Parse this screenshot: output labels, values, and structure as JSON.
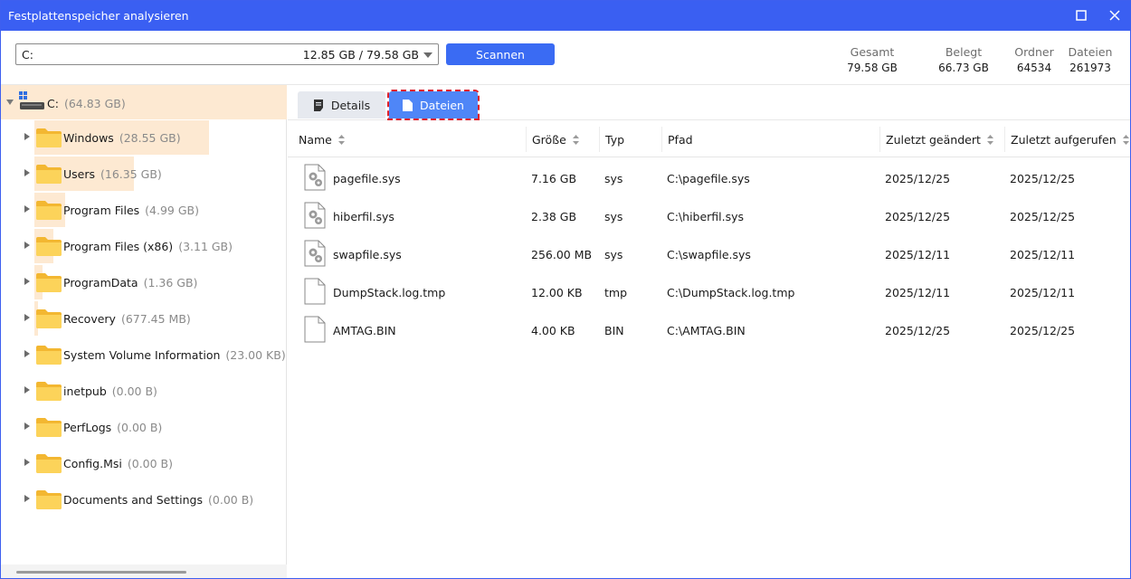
{
  "window": {
    "title": "Festplattenspeicher analysieren"
  },
  "toolbar": {
    "drive_letter": "C:",
    "drive_usage": "12.85 GB / 79.58 GB",
    "scan_label": "Scannen"
  },
  "stats": [
    {
      "label": "Gesamt",
      "value": "79.58 GB"
    },
    {
      "label": "Belegt",
      "value": "66.73 GB"
    },
    {
      "label": "Ordner",
      "value": "64534"
    },
    {
      "label": "Dateien",
      "value": "261973"
    }
  ],
  "tree": {
    "root": {
      "name": "C:",
      "size": "(64.83 GB)"
    },
    "items": [
      {
        "name": "Windows",
        "size": "(28.55 GB)"
      },
      {
        "name": "Users",
        "size": "(16.35 GB)"
      },
      {
        "name": "Program Files",
        "size": "(4.99 GB)"
      },
      {
        "name": "Program Files (x86)",
        "size": "(3.11 GB)"
      },
      {
        "name": "ProgramData",
        "size": "(1.36 GB)"
      },
      {
        "name": "Recovery",
        "size": "(677.45 MB)"
      },
      {
        "name": "System Volume Information",
        "size": "(23.00 KB)"
      },
      {
        "name": "inetpub",
        "size": "(0.00 B)"
      },
      {
        "name": "PerfLogs",
        "size": "(0.00 B)"
      },
      {
        "name": "Config.Msi",
        "size": "(0.00 B)"
      },
      {
        "name": "Documents and Settings",
        "size": "(0.00 B)"
      }
    ],
    "usage_fraction": [
      0.3588,
      0.2055,
      0.0627,
      0.0391,
      0.0171,
      0.0083,
      0.0,
      0.0,
      0.0,
      0.0,
      0.0
    ]
  },
  "tabs": {
    "details": "Details",
    "files": "Dateien"
  },
  "columns": {
    "name": "Name",
    "size": "Größe",
    "type": "Typ",
    "path": "Pfad",
    "modified": "Zuletzt geändert",
    "accessed": "Zuletzt aufgerufen"
  },
  "files": [
    {
      "name": "pagefile.sys",
      "size": "7.16 GB",
      "type": "sys",
      "path": "C:\\pagefile.sys",
      "modified": "2025/12/25",
      "accessed": "2025/12/25",
      "icon": "system-file-icon"
    },
    {
      "name": "hiberfil.sys",
      "size": "2.38 GB",
      "type": "sys",
      "path": "C:\\hiberfil.sys",
      "modified": "2025/12/25",
      "accessed": "2025/12/25",
      "icon": "system-file-icon"
    },
    {
      "name": "swapfile.sys",
      "size": "256.00 MB",
      "type": "sys",
      "path": "C:\\swapfile.sys",
      "modified": "2025/12/11",
      "accessed": "2025/12/11",
      "icon": "system-file-icon"
    },
    {
      "name": "DumpStack.log.tmp",
      "size": "12.00 KB",
      "type": "tmp",
      "path": "C:\\DumpStack.log.tmp",
      "modified": "2025/12/11",
      "accessed": "2025/12/11",
      "icon": "blank-file-icon"
    },
    {
      "name": "AMTAG.BIN",
      "size": "4.00 KB",
      "type": "BIN",
      "path": "C:\\AMTAG.BIN",
      "modified": "2025/12/25",
      "accessed": "2025/12/25",
      "icon": "blank-file-icon"
    }
  ],
  "colors": {
    "accent": "#3a5ff2",
    "scan_button": "#3a6bf3",
    "active_tab": "#4f86f7",
    "tree_highlight": "#fde9d2",
    "folder_yellow": "#f8c83a"
  }
}
